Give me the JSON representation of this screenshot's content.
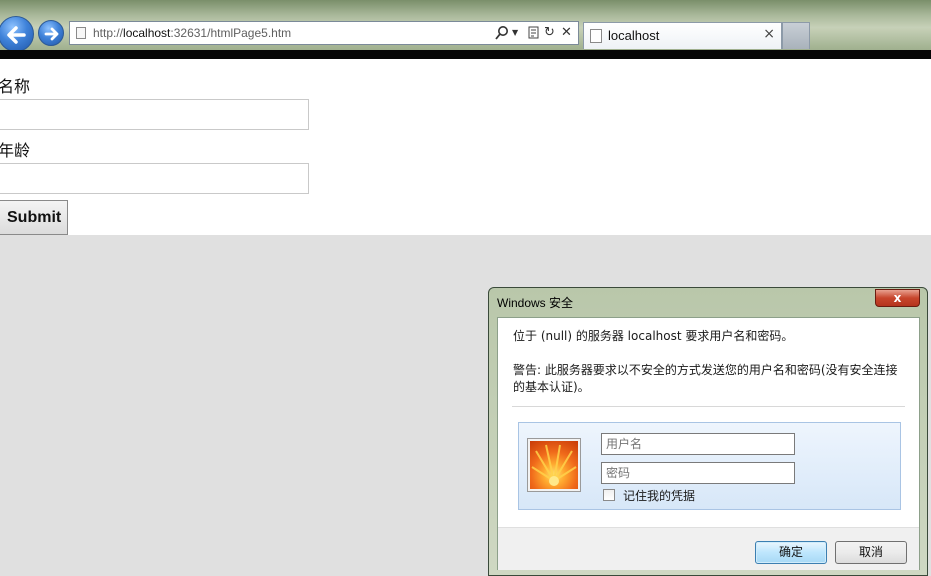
{
  "browser": {
    "url": "http://localhost:32631/htmlPage5.htm",
    "url_prefix": "http://",
    "url_host": "localhost",
    "url_suffix": ":32631/htmlPage5.htm",
    "tab_title": "localhost",
    "tab_close": "×"
  },
  "form": {
    "name_label": "名称",
    "name_value": "",
    "age_label": "年龄",
    "age_value": "",
    "submit_label": "Submit"
  },
  "dialog": {
    "title": "Windows 安全",
    "close_glyph": "x",
    "message": "位于 (null) 的服务器 localhost 要求用户名和密码。",
    "warning_line1": "警告: 此服务器要求以不安全的方式发送您的用户名和密码(没有安全连接",
    "warning_line2": "的基本认证)。",
    "username_placeholder": "用户名",
    "password_placeholder": "密码",
    "remember_label": "记住我的凭据",
    "remember_checked": false,
    "ok_label": "确定",
    "cancel_label": "取消"
  },
  "colors": {
    "page_background": "#e0e0e0",
    "dialog_frame": "#b9c7aa",
    "close_button": "#c7452c",
    "credential_panel": "#d7e7f8"
  },
  "icons": [
    "back-arrow-icon",
    "forward-arrow-icon",
    "page-icon",
    "search-icon",
    "dropdown-icon",
    "compatibility-icon",
    "refresh-icon",
    "stop-icon",
    "close-icon",
    "user-avatar-icon"
  ]
}
